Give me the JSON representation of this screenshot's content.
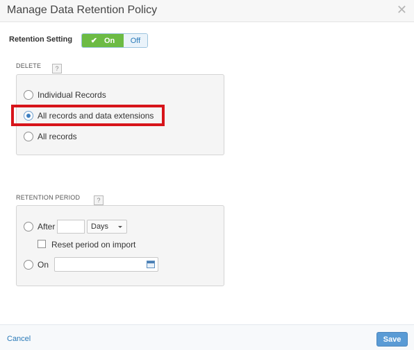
{
  "dialog": {
    "title": "Manage Data Retention Policy",
    "close_icon": "close-icon"
  },
  "retention_setting": {
    "label": "Retention Setting",
    "on_label": "On",
    "off_label": "Off",
    "state": "On",
    "on_color": "#6cbb44"
  },
  "delete_section": {
    "label": "DELETE",
    "help": "?",
    "options": [
      {
        "label": "Individual Records",
        "checked": false
      },
      {
        "label": "All records and data extensions",
        "checked": true
      },
      {
        "label": "All records",
        "checked": false
      }
    ],
    "highlight_color": "#d7141a"
  },
  "retention_period": {
    "label": "RETENTION PERIOD",
    "help": "?",
    "after_label": "After",
    "after_value": "",
    "unit_selected": "Days",
    "reset_label": "Reset period on import",
    "reset_checked": false,
    "on_label": "On",
    "date_value": ""
  },
  "footer": {
    "cancel_label": "Cancel",
    "save_label": "Save"
  }
}
